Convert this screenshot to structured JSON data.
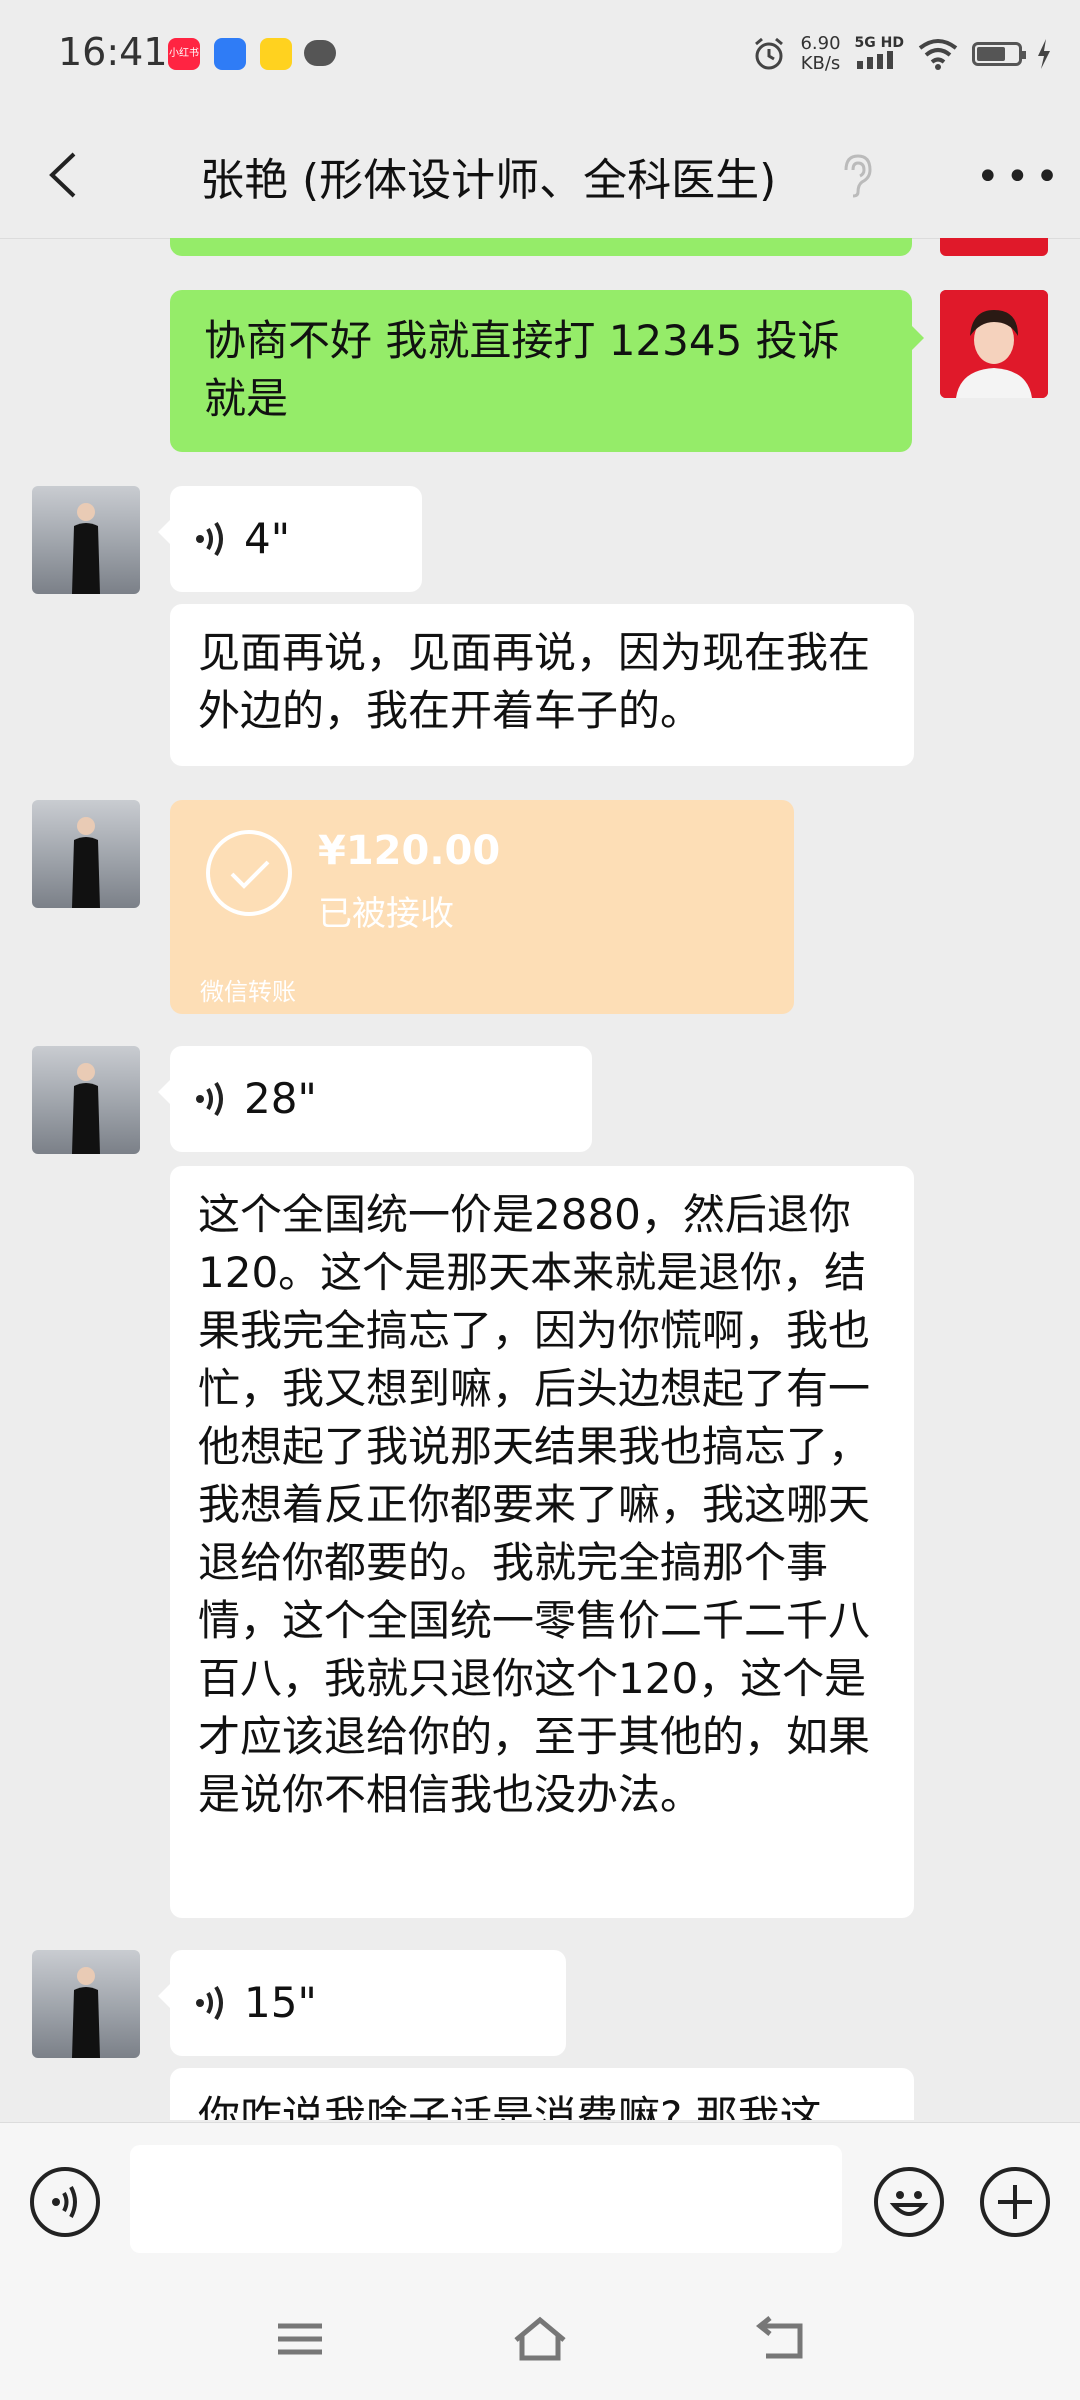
{
  "status_bar": {
    "time": "16:41",
    "app_icon_1_text": "小红书",
    "speed_value": "6.90",
    "speed_unit": "KB/s",
    "network": "5G HD"
  },
  "header": {
    "title": "张艳 (形体设计师、全科医生)"
  },
  "messages": {
    "self_1": "协商不好 我就直接打 12345 投诉就是",
    "voice_1_duration": "4\"",
    "text_1": "见面再说，见面再说，因为现在我在外边的，我在开着车子的。",
    "transfer": {
      "amount": "¥120.00",
      "status": "已被接收",
      "label": "微信转账"
    },
    "voice_2_duration": "28\"",
    "text_2": "这个全国统一价是2880，然后退你120。这个是那天本来就是退你，结果我完全搞忘了，因为你慌啊，我也忙，我又想到嘛，后头边想起了有一他想起了我说那天结果我也搞忘了，我想着反正你都要来了嘛，我这哪天退给你都要的。我就完全搞那个事情，这个全国统一零售价二千二千八百八，我就只退你这个120，这个是才应该退给你的，至于其他的，如果是说你不相信我也没办法。",
    "voice_3_duration": "15\"",
    "text_3_partial": "你咋说我啥子话是消费嘛? 那我这"
  },
  "input": {
    "placeholder": ""
  },
  "icons": {
    "back": "back-arrow-icon",
    "ear": "ear-icon",
    "more": "more-dots-icon",
    "voice": "voice-wave-icon",
    "emoji": "emoji-icon",
    "plus": "plus-icon",
    "nav_menu": "menu-icon",
    "nav_home": "home-icon",
    "nav_back": "back-icon"
  },
  "colors": {
    "self_bubble": "#95ec69",
    "other_bubble": "#ffffff",
    "transfer_card": "#fddeb6",
    "background": "#ededed"
  }
}
